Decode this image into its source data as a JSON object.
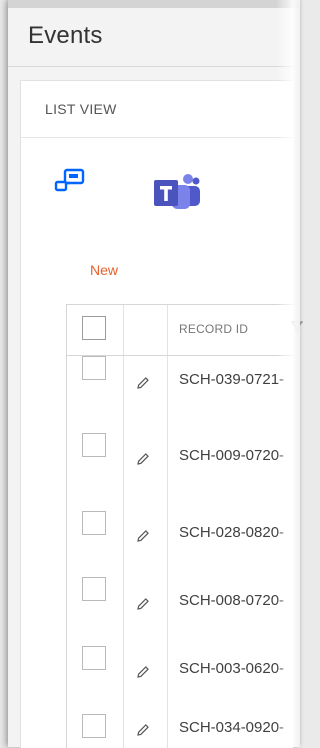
{
  "page": {
    "title": "Events"
  },
  "card": {
    "title": "LIST VIEW"
  },
  "toolbar": {
    "new_label": "New"
  },
  "icons": {
    "power_automate": "power-automate-icon",
    "teams": "teams-icon",
    "edit": "pencil-icon",
    "filter": "filter-icon",
    "colors": {
      "power_automate": "#0066ff",
      "teams": "#5059c9",
      "new_link": "#e8602c"
    }
  },
  "grid": {
    "columns": [
      "",
      "",
      "RECORD ID"
    ],
    "rows": [
      {
        "record_id": "SCH-039-0721-"
      },
      {
        "record_id": "SCH-009-0720-"
      },
      {
        "record_id": "SCH-028-0820-"
      },
      {
        "record_id": "SCH-008-0720-"
      },
      {
        "record_id": "SCH-003-0620-"
      },
      {
        "record_id": "SCH-034-0920-"
      }
    ]
  }
}
